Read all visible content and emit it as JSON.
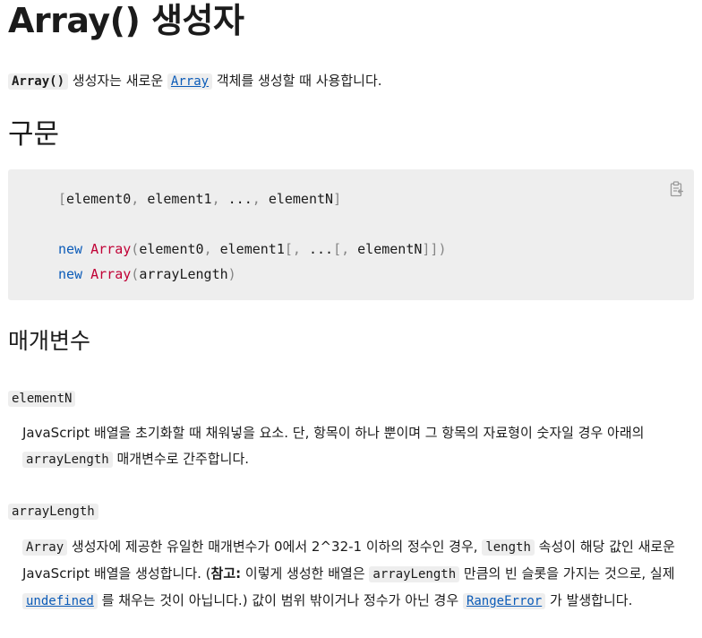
{
  "title": "Array() 생성자",
  "intro": {
    "code": "Array()",
    "text1": " 생성자는 새로운 ",
    "link": "Array",
    "text2": " 객체를 생성할 때 사용합니다."
  },
  "syntax": {
    "heading": "구문",
    "line1": {
      "lb": "[",
      "a": "element0",
      "c1": ", ",
      "b": "element1",
      "c2": ", ",
      "d": "...",
      "c3": ", ",
      "e": "elementN",
      "rb": "]"
    },
    "line2": {
      "kw": "new",
      "cls": "Array",
      "open": "(",
      "a": "element0",
      "c1": ", ",
      "b": "element1",
      "lb1": "[",
      "c2": ", ",
      "d": "...",
      "lb2": "[",
      "c3": ", ",
      "e": "elementN",
      "close": "]])"
    },
    "line3": {
      "kw": "new",
      "cls": "Array",
      "open": "(",
      "a": "arrayLength",
      "close": ")"
    }
  },
  "params": {
    "heading": "매개변수",
    "p1": {
      "name": "elementN",
      "text1": "JavaScript 배열을 초기화할 때 채워넣을 요소. 단, 항목이 하나 뿐이며 그 항목의 자료형이 숫자일 경우 아래의",
      "code": "arrayLength",
      "text2": " 매개변수로 간주합니다."
    },
    "p2": {
      "name": "arrayLength",
      "code1": "Array",
      "text1": " 생성자에 제공한 유일한 매개변수가 0에서 2^32-1 이하의 정수인 경우, ",
      "code2": "length",
      "text2": " 속성이 해당 값인 새로운 JavaScript 배열을 생성합니다. (",
      "note_label": "참고:",
      "text3": " 이렇게 생성한 배열은 ",
      "code3": "arrayLength",
      "text4": " 만큼의 빈 슬롯을 가지는 것으로, 실제 ",
      "link1": "undefined",
      "text5": " 를 채우는 것이 아닙니다.) 값이 범위 밖이거나 정수가 아닌 경우 ",
      "link2": "RangeError",
      "text6": " 가 발생합니다."
    }
  }
}
